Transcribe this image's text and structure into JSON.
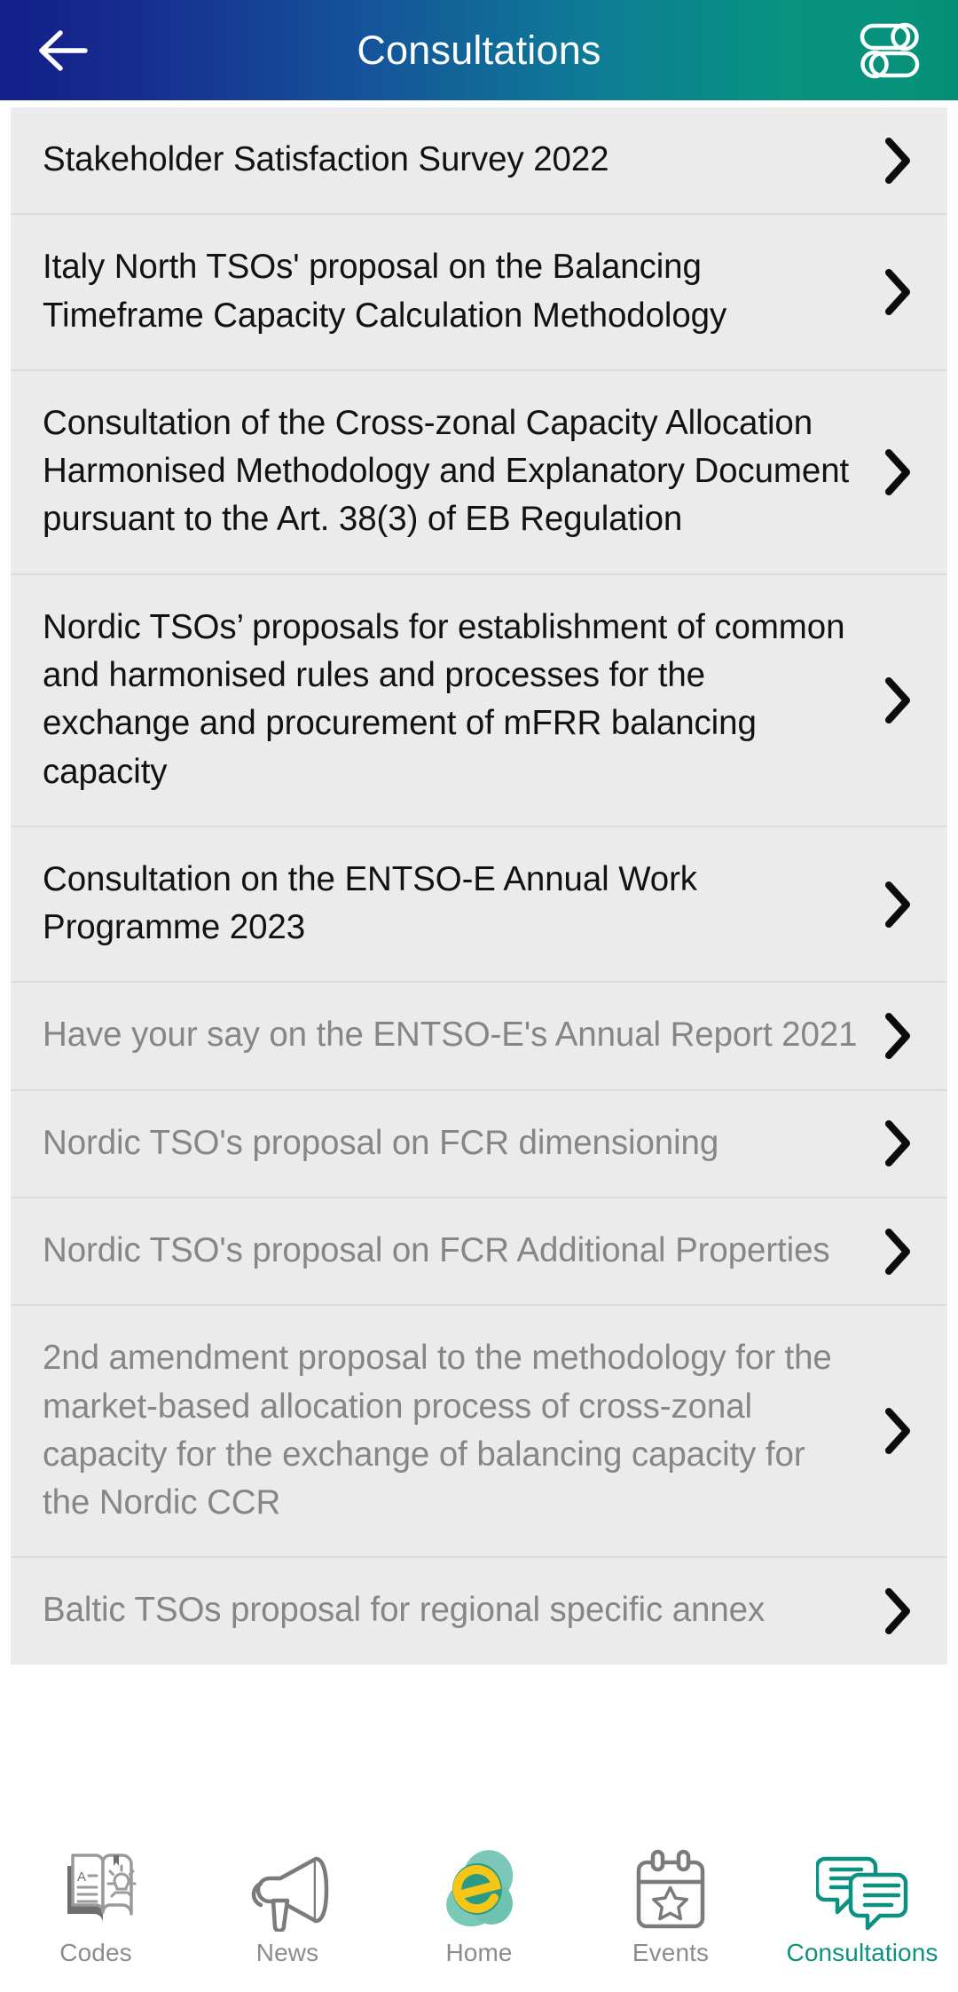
{
  "header": {
    "title": "Consultations",
    "back_icon": "arrow-left-icon",
    "filter_icon": "filter-sliders-icon",
    "gradient_start": "#141f8c",
    "gradient_end": "#049078"
  },
  "list": {
    "chevron_icon": "chevron-right-icon",
    "items": [
      {
        "title": "Stakeholder Satisfaction Survey 2022",
        "dimmed": false
      },
      {
        "title": "Italy North TSOs' proposal on the Balancing Timeframe Capacity Calculation  Methodology",
        "dimmed": false
      },
      {
        "title": "Consultation of the Cross-zonal Capacity Allocation Harmonised Methodology and Explanatory Document pursuant to the Art. 38(3) of EB Regulation",
        "dimmed": false
      },
      {
        "title": "Nordic TSOs’ proposals for establishment of common and harmonised rules and processes for the exchange and procurement of mFRR balancing capacity",
        "dimmed": false
      },
      {
        "title": "Consultation on the ENTSO-E Annual Work Programme 2023",
        "dimmed": false
      },
      {
        "title": "Have your say on the ENTSO-E's Annual Report 2021",
        "dimmed": true
      },
      {
        "title": "Nordic TSO's proposal on FCR dimensioning",
        "dimmed": true
      },
      {
        "title": "Nordic TSO's proposal on FCR Additional Properties",
        "dimmed": true
      },
      {
        "title": "2nd amendment proposal to the methodology for the market-based allocation process of cross-zonal capacity for the exchange of balancing capacity for the Nordic CCR",
        "dimmed": true
      },
      {
        "title": "Baltic TSOs proposal for regional specific annex",
        "dimmed": true
      }
    ]
  },
  "tabbar": {
    "active_color": "#0d9180",
    "inactive_color": "#8c8c8c",
    "tabs": [
      {
        "label": "Codes",
        "icon": "book-lightbulb-icon",
        "active": false
      },
      {
        "label": "News",
        "icon": "megaphone-icon",
        "active": false
      },
      {
        "label": "Home",
        "icon": "entsoe-logo-icon",
        "active": false
      },
      {
        "label": "Events",
        "icon": "calendar-star-icon",
        "active": false
      },
      {
        "label": "Consultations",
        "icon": "speech-bubbles-icon",
        "active": true
      }
    ]
  }
}
